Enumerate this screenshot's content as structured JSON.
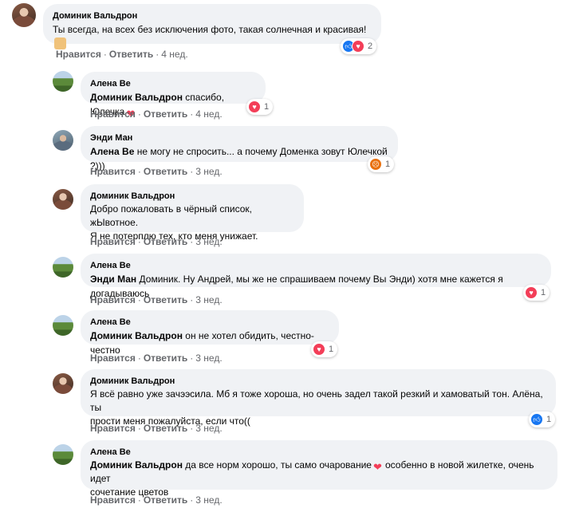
{
  "comments": [
    {
      "author": "Доминик Вальдрон",
      "text": "Ты всегда, на всех без исключения фото, такая солнечная и красивая!",
      "like": "Нравится",
      "reply": "Ответить",
      "time": "4 нед.",
      "reactions": {
        "icons": [
          "like-icon",
          "love-icon"
        ],
        "count": "2"
      }
    },
    {
      "author": "Алена Ве",
      "mention": "Доминик Вальдрон",
      "text": "спасибо, Юлечка",
      "like": "Нравится",
      "reply": "Ответить",
      "time": "4 нед.",
      "reactions": {
        "icons": [
          "love-icon"
        ],
        "count": "1"
      }
    },
    {
      "author": "Энди Ман",
      "mention": "Алена Ве",
      "text": "не могу не спросить... а почему Доменка зовут Юлечкой ?)))",
      "like": "Нравится",
      "reply": "Ответить",
      "time": "3 нед.",
      "reactions": {
        "icons": [
          "angry-icon"
        ],
        "count": "1"
      }
    },
    {
      "author": "Доминик Вальдрон",
      "text_line1": "Добро пожаловать в чёрный список, жЫвотное.",
      "text_line2": "Я не потерплю тех, кто меня унижает.",
      "like": "Нравится",
      "reply": "Ответить",
      "time": "3 нед."
    },
    {
      "author": "Алена Ве",
      "mention": "Энди Ман",
      "text": "Доминик. Ну Андрей, мы же не спрашиваем почему Вы Энди) хотя мне кажется я догадываюсь",
      "like": "Нравится",
      "reply": "Ответить",
      "time": "3 нед.",
      "reactions": {
        "icons": [
          "love-icon"
        ],
        "count": "1"
      }
    },
    {
      "author": "Алена Ве",
      "mention": "Доминик Вальдрон",
      "text": "он не хотел обидить, честно-честно",
      "like": "Нравится",
      "reply": "Ответить",
      "time": "3 нед.",
      "reactions": {
        "icons": [
          "love-icon"
        ],
        "count": "1"
      }
    },
    {
      "author": "Доминик Вальдрон",
      "text_line1": "Я всё равно уже зачээсила. Мб я тоже хороша, но очень задел такой резкий и хамоватый тон. Алёна, ты",
      "text_line2": "прости меня пожалуйста, если что((",
      "like": "Нравится",
      "reply": "Ответить",
      "time": "3 нед.",
      "reactions": {
        "icons": [
          "like-icon"
        ],
        "count": "1"
      }
    },
    {
      "author": "Алена Ве",
      "mention": "Доминик Вальдрон",
      "text_part1": "да все норм хорошо, ты само очарование",
      "text_part2": "особенно в новой жилетке, очень идет",
      "text_line2": "сочетание цветов",
      "like": "Нравится",
      "reply": "Ответить",
      "time": "3 нед."
    }
  ],
  "colors": {
    "bubble": "#f0f2f5",
    "meta": "#65676b",
    "like": "#1877f2",
    "love": "#f33e58",
    "angry": "#e9710f"
  }
}
